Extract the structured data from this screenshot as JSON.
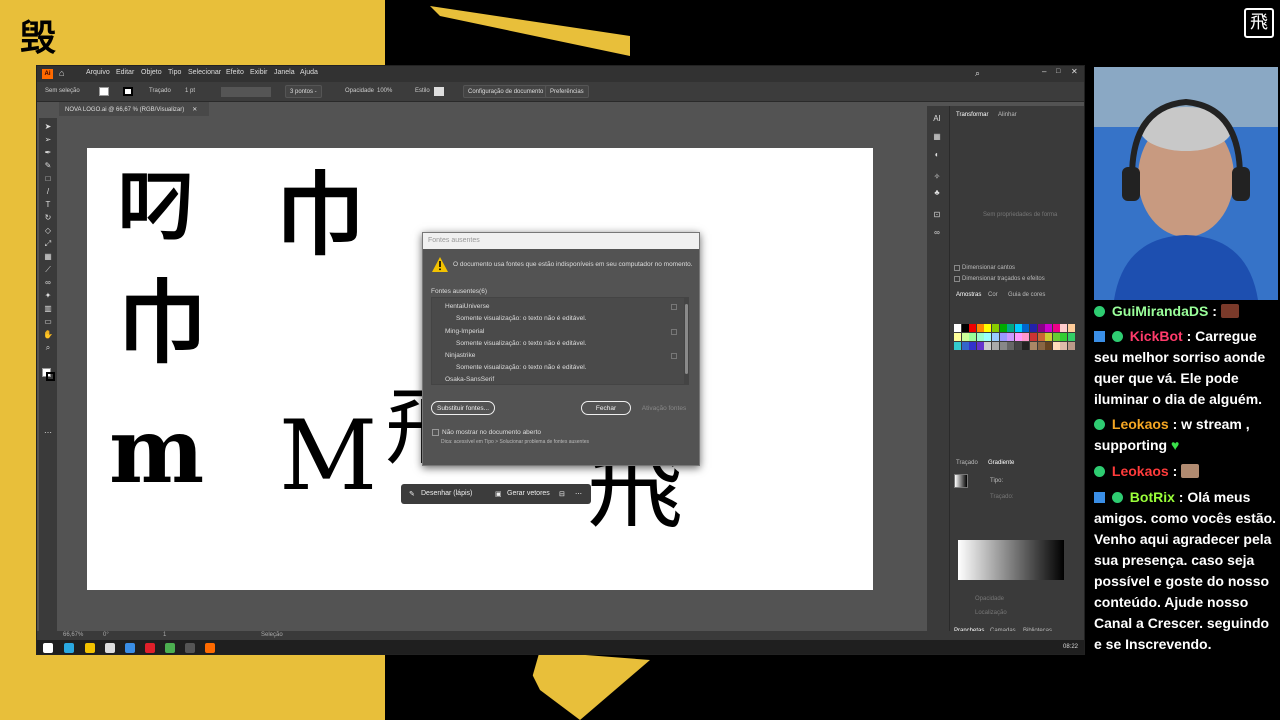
{
  "illustrator": {
    "menu": [
      "Arquivo",
      "Editar",
      "Objeto",
      "Tipo",
      "Selecionar",
      "Efeito",
      "Exibir",
      "Janela",
      "Ajuda"
    ],
    "control": {
      "selection": "Sem seleção",
      "stroke_label": "Traçado",
      "stroke_value": "1 pt",
      "brush": "3 pontos -",
      "opacity_label": "Opacidade",
      "opacity_value": "100%",
      "style_label": "Estilo",
      "doc_setup": "Configuração de documento",
      "prefs": "Preferências"
    },
    "document_tab": "NOVA LOGO.ai @ 66,67 % (RGB/Visualizar)",
    "status": {
      "zoom": "66,67%",
      "angle": "0°",
      "artboard": "1",
      "tool": "Seleção"
    },
    "panels": {
      "transform_tabs": [
        "Transformar",
        "Alinhar"
      ],
      "no_selection": "Sem propriedades de forma",
      "scale_corners": "Dimensionar cantos",
      "scale_strokes": "Dimensionar traçados e efeitos",
      "swatch_tabs": [
        "Amostras",
        "Cor",
        "Guia de cores"
      ],
      "gradient_tabs": [
        "Traçado",
        "Gradiente"
      ],
      "gradient_type": "Tipo:",
      "gradient_stroke": "Traçado:",
      "gradient_opacity": "Opacidade",
      "gradient_location": "Localização",
      "bottom_tabs": [
        "Pranchetas",
        "Camadas",
        "Bibliotecas"
      ]
    },
    "time": "08:22"
  },
  "dialog": {
    "title": "Fontes ausentes",
    "message": "O documento usa fontes que estão indisponíveis em seu computador no momento.",
    "missing_header": "Fontes ausentes(6)",
    "fonts": [
      {
        "name": "HentaiUniverse",
        "note": "Somente visualização: o texto não é editável."
      },
      {
        "name": "Ming-Imperial",
        "note": "Somente visualização: o texto não é editável."
      },
      {
        "name": "Ninjastrike",
        "note": "Somente visualização: o texto não é editável."
      },
      {
        "name": "Osaka-SansSerif",
        "note": ""
      }
    ],
    "replace_button": "Substituir fontes...",
    "close_button": "Fechar",
    "activate_button": "Ativação fontes",
    "dont_show": "Não mostrar no documento aberto",
    "tip": "Dica: acessível em Tipo > Solucionar problema de fontes ausentes"
  },
  "context_bar": {
    "draw_label": "Desenhar (lápis)",
    "vectors_label": "Gerar vetores"
  },
  "chat": [
    {
      "user": "GuiMirandaDS",
      "color": "#9aff9a",
      "text": ":"
    },
    {
      "user": "KickBot",
      "color": "#ff3b6b",
      "text": ": Carregue seu melhor sorriso aonde quer que vá. Ele pode iluminar o dia de alguém."
    },
    {
      "user": "Leokaos",
      "color": "#f5a623",
      "text": ": w stream , supporting"
    },
    {
      "user": "Leokaos",
      "color": "#ff3b3b",
      "text": ":"
    },
    {
      "user": "BotRix",
      "color": "#9aff3a",
      "text": ": Olá meus amigos. como vocês estão. Venho aqui agradecer pela sua presença. caso seja possível e goste do nosso conteúdo. Ajude nosso Canal a Crescer. seguindo e se Inscrevendo."
    }
  ]
}
